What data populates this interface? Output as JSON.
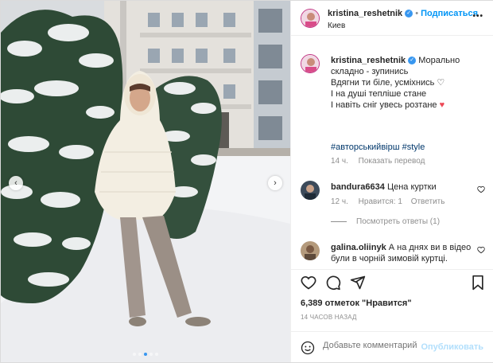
{
  "post": {
    "username": "kristina_reshetnik",
    "follow_label": "Подписаться",
    "location": "Киев",
    "more_label": "•••"
  },
  "caption": {
    "username": "kristina_reshetnik",
    "line1": "Морально",
    "line2": "складно - зупинись",
    "line3": "Вдягни ти біле, усміхнись",
    "line4": "І на душі тепліше стане",
    "line5": "І навіть сніг увесь розтане",
    "hashtags": "#авторськийвірш #style",
    "time": "14 ч.",
    "translate_label": "Показать перевод"
  },
  "comments": [
    {
      "username": "bandura6634",
      "text": "Цена куртки",
      "time": "12 ч.",
      "likes": "Нравится: 1",
      "reply": "Ответить",
      "view_replies": "Посмотреть ответы (1)"
    },
    {
      "username": "galina.oliinyk",
      "text_line1": "А на днях ви в відео",
      "text_line2": "були в чорній зимовій куртці."
    }
  ],
  "stats": {
    "likes": "6,389 отметок \"Нравится\"",
    "posted": "14 ЧАСОВ НАЗАД"
  },
  "add_comment": {
    "placeholder": "Добавьте комментарий...",
    "publish_label": "Опубликовать"
  },
  "icons": {
    "like": "heart-icon",
    "comment": "comment-icon",
    "share": "send-icon",
    "save": "bookmark-icon",
    "emoji": "emoji-icon",
    "verified": "verified-badge-icon"
  },
  "colors": {
    "accent": "#0095f6",
    "verified": "#3897f0",
    "heart_red": "#ed4956",
    "muted": "#8e8e8e"
  }
}
